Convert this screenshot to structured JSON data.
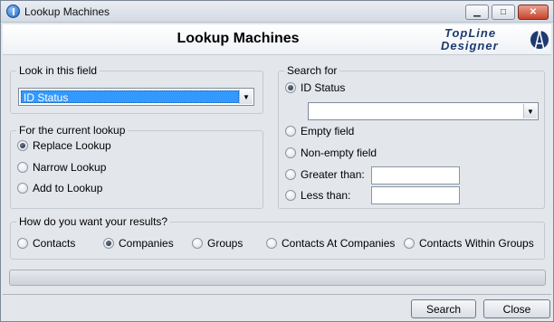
{
  "window": {
    "title": "Lookup Machines"
  },
  "header": {
    "title": "Lookup Machines",
    "logo_line1": "TopLine",
    "logo_line2": "Designer"
  },
  "look_in": {
    "label": "Look in this field",
    "selected": "ID Status"
  },
  "current_lookup": {
    "label": "For the current lookup",
    "options": [
      "Replace Lookup",
      "Narrow Lookup",
      "Add to Lookup"
    ],
    "selected": "Replace Lookup"
  },
  "search_for": {
    "label": "Search for",
    "options": [
      "ID Status",
      "Empty field",
      "Non-empty field",
      "Greater than:",
      "Less than:"
    ],
    "selected": "ID Status",
    "value_select": "",
    "greater_than": "",
    "less_than": ""
  },
  "results": {
    "label": "How do you want your results?",
    "options": [
      "Contacts",
      "Companies",
      "Groups",
      "Contacts At Companies",
      "Contacts Within Groups"
    ],
    "selected": "Companies"
  },
  "buttons": {
    "search": "Search",
    "close": "Close"
  },
  "icons": {
    "minimize": "minimize-icon",
    "maximize": "maximize-icon",
    "close": "close-icon"
  }
}
